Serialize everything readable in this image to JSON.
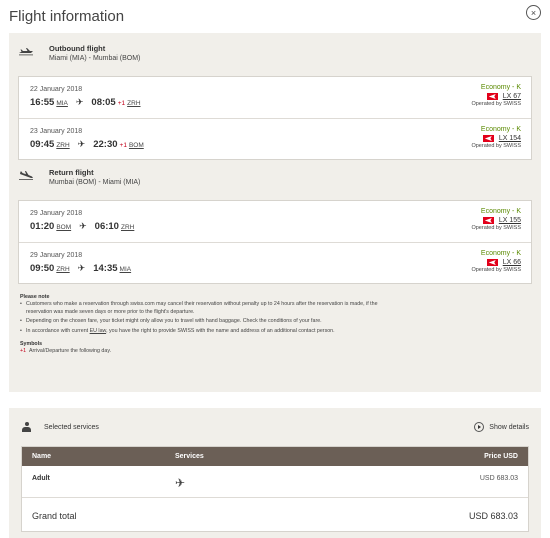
{
  "page": {
    "title": "Flight information",
    "close_symbol": "×"
  },
  "outbound": {
    "heading": "Outbound flight",
    "route": "Miami (MIA) - Mumbai (BOM)",
    "icon": "plane-departure-icon",
    "segments": [
      {
        "date": "22 January 2018",
        "dep_time": "16:55",
        "dep_ap": "MIA",
        "arr_time": "08:05",
        "arr_plus": "+1",
        "arr_ap": "ZRH",
        "fare": "Economy - K",
        "flight": "LX 67",
        "operated": "Operated by SWISS"
      },
      {
        "date": "23 January 2018",
        "dep_time": "09:45",
        "dep_ap": "ZRH",
        "arr_time": "22:30",
        "arr_plus": "+1",
        "arr_ap": "BOM",
        "fare": "Economy - K",
        "flight": "LX 154",
        "operated": "Operated by SWISS"
      }
    ]
  },
  "return": {
    "heading": "Return flight",
    "route": "Mumbai (BOM) - Miami (MIA)",
    "icon": "plane-arrival-icon",
    "segments": [
      {
        "date": "29 January 2018",
        "dep_time": "01:20",
        "dep_ap": "BOM",
        "arr_time": "06:10",
        "arr_plus": "",
        "arr_ap": "ZRH",
        "fare": "Economy - K",
        "flight": "LX 155",
        "operated": "Operated by SWISS"
      },
      {
        "date": "29 January 2018",
        "dep_time": "09:50",
        "dep_ap": "ZRH",
        "arr_time": "14:35",
        "arr_plus": "",
        "arr_ap": "MIA",
        "fare": "Economy - K",
        "flight": "LX 66",
        "operated": "Operated by SWISS"
      }
    ]
  },
  "notes": {
    "heading": "Please note",
    "item1": "Customers who make a reservation through swiss.com may cancel their reservation without penalty up to 24 hours after the reservation is made, if the reservation was made seven days or more prior to the flight's departure.",
    "item2": "Depending on the chosen fare, your ticket might only allow you to travel with hand baggage. Check the conditions of your fare.",
    "item3_pre": "In accordance with current ",
    "item3_link": "EU law",
    "item3_post": ", you have the right to provide SWISS with the name and address of an additional contact person.",
    "symbols_heading": "Symbols",
    "symbol_mark": "+1",
    "symbol_text": "Arrival/Departure the following day."
  },
  "services": {
    "heading": "Selected services",
    "show_details": "Show details",
    "col_name": "Name",
    "col_services": "Services",
    "col_price": "Price USD",
    "row_name": "Adult",
    "row_service_icon": "airplane-icon",
    "row_price": "USD 683.03",
    "total_label": "Grand total",
    "total_value": "USD  683.03"
  },
  "colors": {
    "fare_green": "#5a8a00",
    "swiss_red": "#e2001a",
    "header_brown": "#6b5f56",
    "panel_beige": "#f1efea"
  }
}
